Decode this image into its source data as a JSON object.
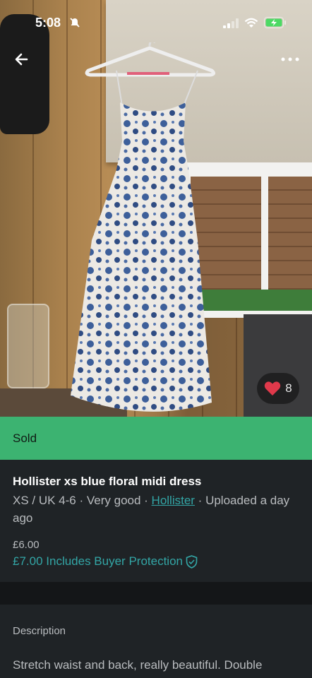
{
  "status_bar": {
    "time": "5:08"
  },
  "listing": {
    "likes": "8",
    "status_banner": "Sold",
    "title": "Hollister xs blue floral midi dress",
    "size": "XS / UK 4-6",
    "condition": "Very good",
    "brand": "Hollister",
    "uploaded": "Uploaded a day ago",
    "separator": " · ",
    "price": "£6.00",
    "price_with_protection": "£7.00 Includes Buyer Protection",
    "description_label": "Description",
    "description_text": "Stretch waist and back, really beautiful. Double"
  },
  "colors": {
    "sold_green": "#3cb371",
    "accent_teal": "#33a6a6",
    "heart_red": "#e0394b"
  },
  "icons": [
    "bell-slash-icon",
    "signal-icon",
    "wifi-icon",
    "battery-charging-icon",
    "back-arrow-icon",
    "more-options-icon",
    "heart-icon",
    "shield-check-icon"
  ]
}
